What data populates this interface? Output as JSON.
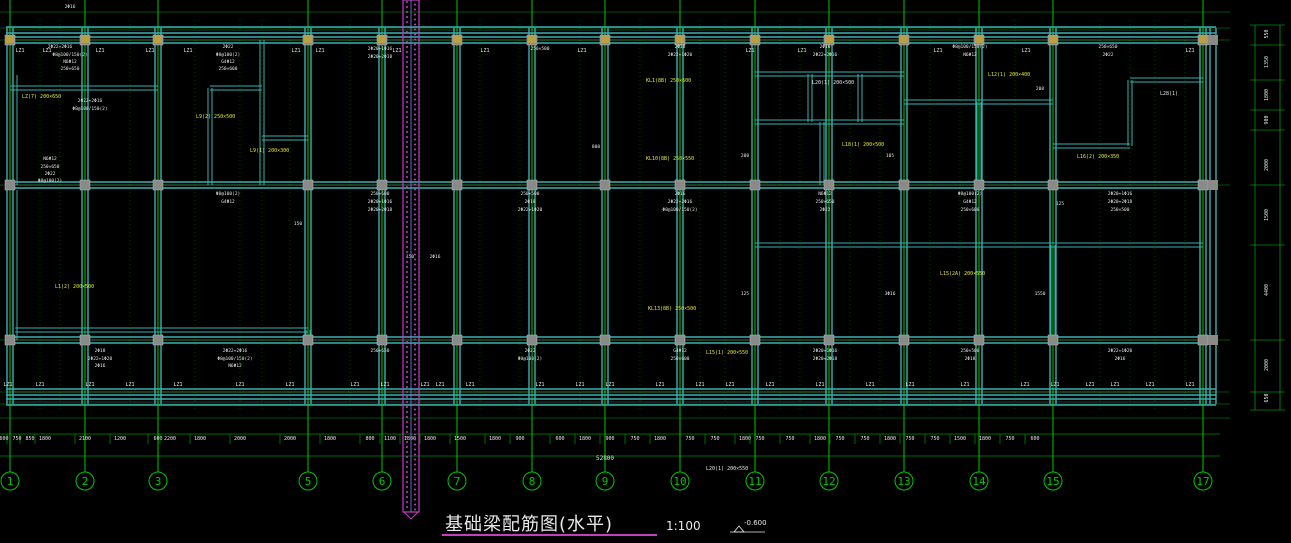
{
  "drawing": {
    "title": "基础梁配筋图(水平)",
    "scale": "1:100",
    "elevation": "-0.600",
    "total_length": "52800"
  },
  "axes": {
    "labels": [
      "1",
      "2",
      "3",
      "5",
      "6",
      "7",
      "8",
      "9",
      "10",
      "11",
      "12",
      "13",
      "14",
      "15",
      "17"
    ]
  },
  "dimensions": {
    "bottom": [
      "600",
      "750",
      "850",
      "1800",
      "2100",
      "1200",
      "600",
      "2200",
      "1800",
      "2000",
      "2000",
      "1800",
      "800",
      "1100",
      "1800",
      "1800",
      "1500",
      "1800",
      "900",
      "600",
      "1800",
      "900",
      "750",
      "1800",
      "750",
      "750",
      "1800",
      "750",
      "750",
      "1800",
      "750",
      "750",
      "1800",
      "750",
      "750",
      "1500",
      "1800",
      "750",
      "600"
    ],
    "right": [
      "550",
      "1350",
      "1800",
      "900",
      "2000",
      "1500",
      "4400",
      "2000",
      "650"
    ]
  },
  "labels": {
    "lz1": "LZ1",
    "beam_labels": [
      {
        "text": "LZ(7) 200×650",
        "color": "yellow"
      },
      {
        "text": "L1(2) 200×500",
        "color": "yellow"
      },
      {
        "text": "L9(2) 250×500",
        "color": "yellow"
      },
      {
        "text": "L9(1) 200×300",
        "color": "yellow"
      },
      {
        "text": "KL1(8B) 250×600",
        "color": "yellow"
      },
      {
        "text": "KL10(8B) 250×550",
        "color": "yellow"
      },
      {
        "text": "L20(1) 200×500",
        "color": "white"
      },
      {
        "text": "L18(1) 200×500",
        "color": "yellow"
      },
      {
        "text": "L12(1) 200×400",
        "color": "yellow"
      },
      {
        "text": "L16(2) 200×350",
        "color": "yellow"
      },
      {
        "text": "L28(1)",
        "color": "white"
      },
      {
        "text": "L15(2A) 200×550",
        "color": "yellow"
      },
      {
        "text": "KL13(8B) 250×500",
        "color": "yellow"
      },
      {
        "text": "L15(1) 200×550",
        "color": "yellow"
      },
      {
        "text": "L20(1) 200×550",
        "color": "white"
      }
    ],
    "rebar_notes": [
      "2Φ16",
      "2Φ22+2Φ16",
      "Φ8@100/150(2)",
      "N6Φ12",
      "250×650",
      "2Φ22",
      "Φ8@100(2)",
      "G4Φ12",
      "250×600",
      "2Φ20+1Φ16",
      "2Φ20+2Φ18",
      "250×500",
      "2Φ18",
      "2Φ22+1Φ20"
    ],
    "misc_dims": [
      "150",
      "200",
      "125",
      "105",
      "3Φ16",
      "1550",
      "800",
      "2Φ16"
    ]
  },
  "colors": {
    "background": "#000000",
    "beam": "#3ab0b0",
    "beam_inner": "#e0f0f0",
    "axis": "#00c800",
    "column": "#8a8a8a",
    "column_yellow": "#b8a048",
    "text_yellow": "#e8e830",
    "text_white": "#e8e8e8",
    "magenta": "#c040c0",
    "dim": "#00d000"
  }
}
